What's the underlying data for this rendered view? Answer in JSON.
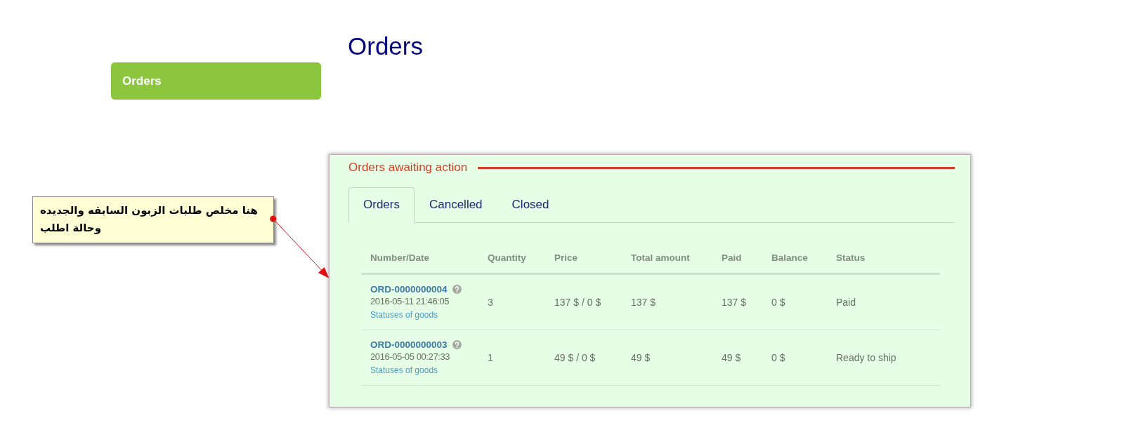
{
  "sidebar": {
    "items": [
      {
        "label": "Orders",
        "selected": true
      }
    ]
  },
  "page_title": "Orders",
  "panel": {
    "legend": "Orders awaiting action",
    "tabs": [
      {
        "label": "Orders",
        "selected": true
      },
      {
        "label": "Cancelled",
        "selected": false
      },
      {
        "label": "Closed",
        "selected": false
      }
    ],
    "table": {
      "columns": [
        "Number/Date",
        "Quantity",
        "Price",
        "Total amount",
        "Paid",
        "Balance",
        "Status"
      ],
      "rows": [
        {
          "number": "ORD-0000000004",
          "date": "2016-05-11 21:46:05",
          "link": "Statuses of goods",
          "quantity": "3",
          "price": "137 $ / 0 $",
          "total": "137 $",
          "paid": "137 $",
          "balance": "0 $",
          "status": "Paid"
        },
        {
          "number": "ORD-0000000003",
          "date": "2016-05-05 00:27:33",
          "link": "Statuses of goods",
          "quantity": "1",
          "price": "49 $ / 0 $",
          "total": "49 $",
          "paid": "49 $",
          "balance": "0 $",
          "status": "Ready to ship"
        }
      ]
    }
  },
  "callout": {
    "text": "هنا مخلص طلبات الزبون السابقه والجديده وحالة اطلب"
  }
}
